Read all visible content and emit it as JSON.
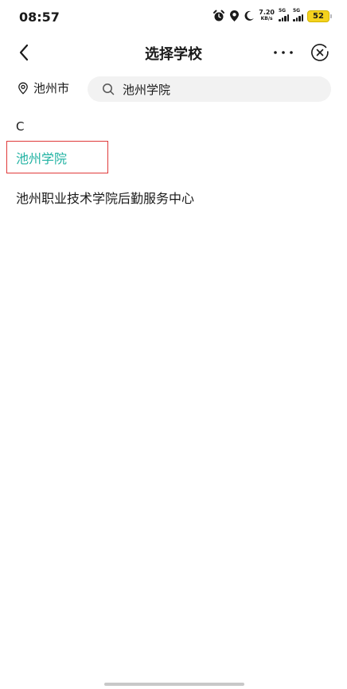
{
  "status_bar": {
    "time": "08:57",
    "net_speed_value": "7.20",
    "net_speed_unit": "KB/s",
    "signal1_label": "5G",
    "signal2_label": "5G",
    "battery": "52"
  },
  "nav": {
    "title": "选择学校"
  },
  "search": {
    "city": "池州市",
    "query": "池州学院"
  },
  "results": {
    "section_letter": "C",
    "items": [
      {
        "label": "池州学院",
        "selected": true
      },
      {
        "label": "池州职业技术学院后勤服务中心",
        "selected": false
      }
    ]
  },
  "colors": {
    "selected_text": "#20b2a2",
    "highlight_border": "#e03a3a",
    "battery": "#f4d21e"
  }
}
